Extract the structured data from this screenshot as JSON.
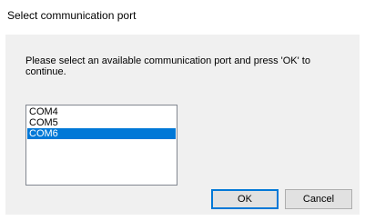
{
  "window": {
    "title": "Select communication port"
  },
  "dialog": {
    "message": "Please select an available communication port and press 'OK' to continue.",
    "ports": [
      "COM4",
      "COM5",
      "COM6"
    ],
    "selected_port": "COM6"
  },
  "buttons": {
    "ok_label": "OK",
    "cancel_label": "Cancel"
  },
  "colors": {
    "selection": "#0078d7",
    "dialog_background": "#f0f0f0",
    "default_button_border": "#0078d7"
  }
}
